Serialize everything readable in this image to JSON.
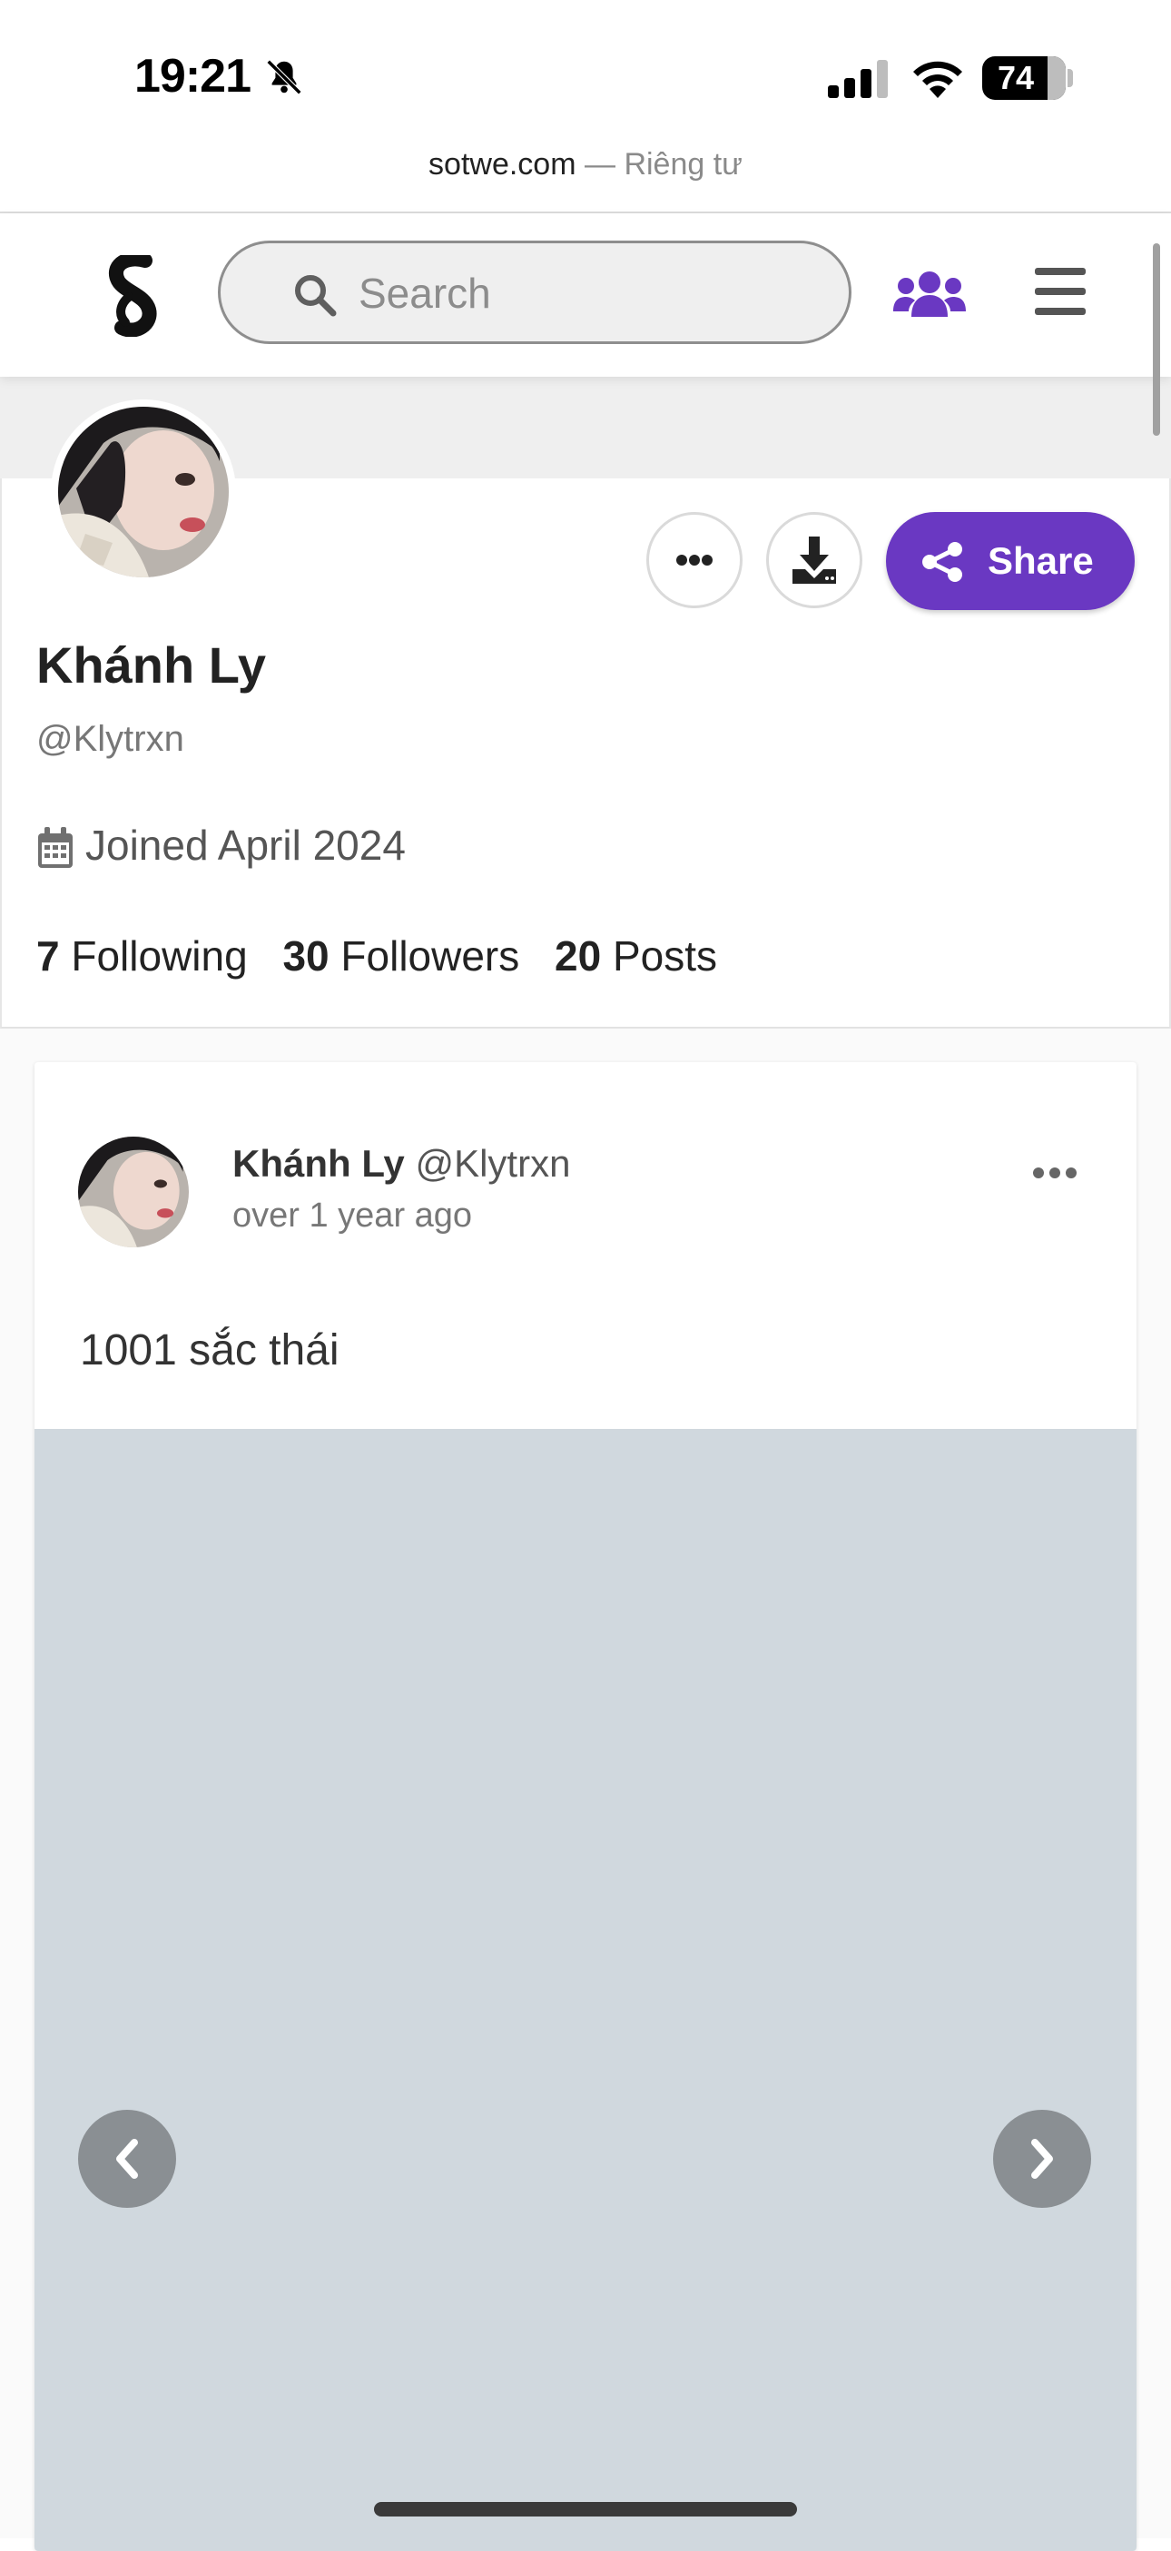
{
  "status_bar": {
    "time": "19:21",
    "battery": "74"
  },
  "browser": {
    "domain": "sotwe.com",
    "suffix": " — Riêng tư"
  },
  "header": {
    "search_placeholder": "Search"
  },
  "profile": {
    "name": "Khánh Ly",
    "handle": "@Klytrxn",
    "joined": "Joined April 2024",
    "share_label": "Share",
    "stats": [
      {
        "count": "7",
        "label": "Following"
      },
      {
        "count": "30",
        "label": "Followers"
      },
      {
        "count": "20",
        "label": "Posts"
      }
    ]
  },
  "post": {
    "author": "Khánh Ly",
    "handle": "@Klytrxn",
    "time": "over 1 year ago",
    "text": "1001 sắc thái"
  },
  "colors": {
    "accent": "#6a38c2",
    "media_bg": "#d0d8de"
  },
  "icons": [
    "bell-slash-icon",
    "signal-icon",
    "wifi-icon",
    "battery-icon",
    "logo-icon",
    "search-icon",
    "users-icon",
    "menu-icon",
    "more-icon",
    "download-icon",
    "share-icon",
    "calendar-icon",
    "chevron-left-icon",
    "chevron-right-icon"
  ]
}
